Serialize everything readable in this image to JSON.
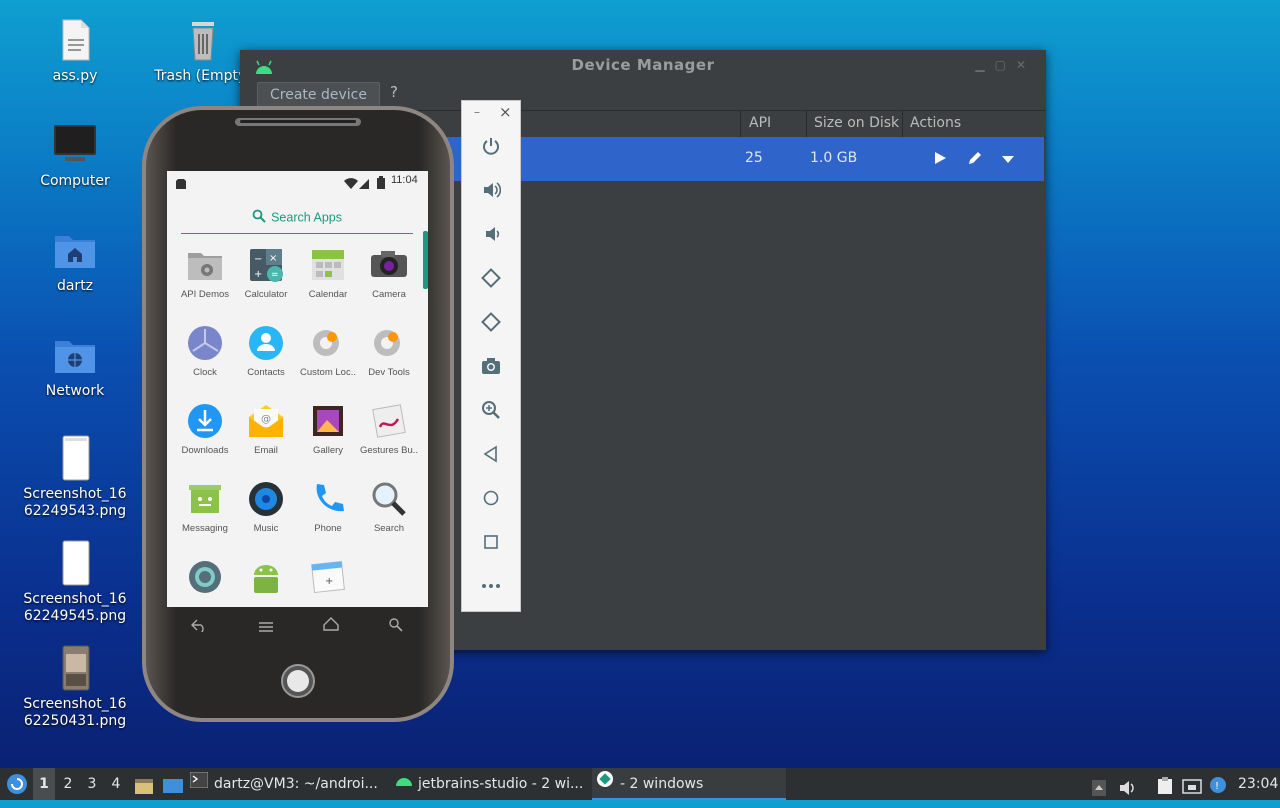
{
  "desktop": {
    "icons": [
      {
        "label": "ass.py"
      },
      {
        "label": "Trash (Empty)"
      },
      {
        "label": "Computer"
      },
      {
        "label": "dartz"
      },
      {
        "label": "Network"
      },
      {
        "label": "Screenshot_1662249543.png"
      },
      {
        "label": "Screenshot_1662249545.png"
      },
      {
        "label": "Screenshot_1662250431.png"
      }
    ]
  },
  "device_manager": {
    "title": "Device Manager",
    "create_label": "Create device",
    "help_label": "?",
    "columns": {
      "api": "API",
      "size": "Size on Disk",
      "actions": "Actions"
    },
    "rows": [
      {
        "api": "25",
        "size": "1.0 GB"
      }
    ]
  },
  "emulator_toolbar": {
    "minimize": "–",
    "close": "×",
    "buttons": [
      "power-icon",
      "volume-up-icon",
      "volume-down-icon",
      "rotate-left-icon",
      "rotate-right-icon",
      "camera-icon",
      "zoom-icon",
      "back-icon",
      "home-icon",
      "overview-icon",
      "more-icon"
    ]
  },
  "phone": {
    "time": "11:04",
    "search_label": "Search Apps",
    "apps": [
      {
        "label": "API Demos",
        "icon": "folder-gear-icon"
      },
      {
        "label": "Calculator",
        "icon": "calculator-icon"
      },
      {
        "label": "Calendar",
        "icon": "calendar-icon"
      },
      {
        "label": "Camera",
        "icon": "camera-icon"
      },
      {
        "label": "Clock",
        "icon": "clock-icon"
      },
      {
        "label": "Contacts",
        "icon": "contacts-icon"
      },
      {
        "label": "Custom Loc..",
        "icon": "gear-icon"
      },
      {
        "label": "Dev Tools",
        "icon": "gear-icon"
      },
      {
        "label": "Downloads",
        "icon": "download-icon"
      },
      {
        "label": "Email",
        "icon": "email-icon"
      },
      {
        "label": "Gallery",
        "icon": "gallery-icon"
      },
      {
        "label": "Gestures Bu..",
        "icon": "gestures-icon"
      },
      {
        "label": "Messaging",
        "icon": "messaging-icon"
      },
      {
        "label": "Music",
        "icon": "music-icon"
      },
      {
        "label": "Phone",
        "icon": "phone-icon"
      },
      {
        "label": "Search",
        "icon": "search-icon"
      },
      {
        "label": "",
        "icon": "settings-icon"
      },
      {
        "label": "",
        "icon": "android-icon"
      },
      {
        "label": "",
        "icon": "widget-preview-icon"
      }
    ]
  },
  "taskbar": {
    "workspaces": [
      "1",
      "2",
      "3",
      "4"
    ],
    "tasks": [
      {
        "label": "dartz@VM3: ~/androi..."
      },
      {
        "label": "jetbrains-studio - 2 wi..."
      },
      {
        "label": "- 2 windows"
      }
    ],
    "clock": "23:04"
  }
}
